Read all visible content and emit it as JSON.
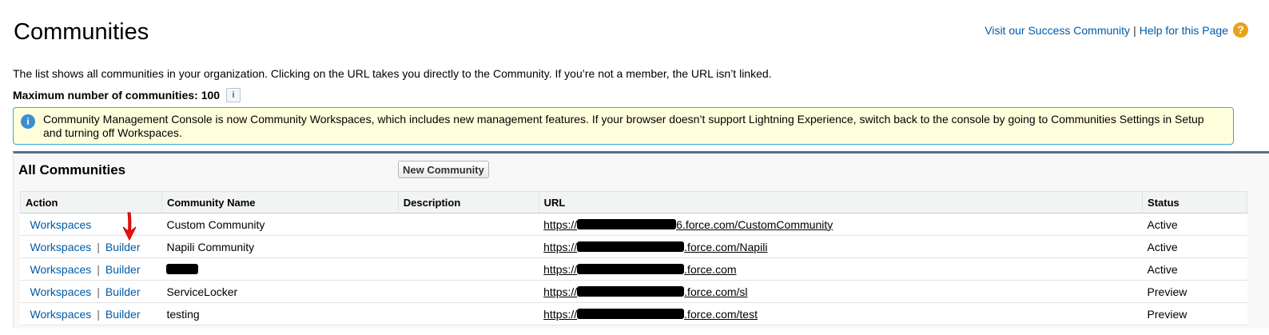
{
  "header": {
    "title": "Communities",
    "success_link": "Visit our Success Community",
    "separator": "|",
    "help_link": "Help for this Page",
    "help_icon": "help-icon"
  },
  "intro": {
    "description": "The list shows all communities in your organization. Clicking on the URL takes you directly to the Community. If you’re not a member, the URL isn’t linked.",
    "max_label": "Maximum number of communities: 100",
    "info_icon": "info-icon"
  },
  "banner": {
    "icon": "info-icon",
    "text": "Community Management Console is now Community Workspaces, which includes new management features. If your browser doesn’t support Lightning Experience, switch back to the console by going to Communities Settings in Setup and turning off Workspaces."
  },
  "panel": {
    "title": "All Communities",
    "new_button": "New Community"
  },
  "table": {
    "columns": [
      "Action",
      "Community Name",
      "Description",
      "URL",
      "Status"
    ],
    "rows": [
      {
        "workspaces": "Workspaces",
        "builder": "",
        "name": "Custom Community",
        "description": "",
        "url_prefix": "https://",
        "url_suffix": "6.force.com/CustomCommunity",
        "status": "Active"
      },
      {
        "workspaces": "Workspaces",
        "builder": "Builder",
        "name": "Napili Community",
        "description": "",
        "url_prefix": "https://",
        "url_suffix": ".force.com/Napili",
        "status": "Active"
      },
      {
        "workspaces": "Workspaces",
        "builder": "Builder",
        "name": "",
        "description": "",
        "url_prefix": "https://",
        "url_suffix": ".force.com",
        "status": "Active"
      },
      {
        "workspaces": "Workspaces",
        "builder": "Builder",
        "name": "ServiceLocker",
        "description": "",
        "url_prefix": "https://",
        "url_suffix": ".force.com/sl",
        "status": "Preview"
      },
      {
        "workspaces": "Workspaces",
        "builder": "Builder",
        "name": "testing",
        "description": "",
        "url_prefix": "https://",
        "url_suffix": ".force.com/test",
        "status": "Preview"
      }
    ]
  },
  "annotation": {
    "icon": "arrow-down-icon",
    "color": "#e8140f"
  },
  "colors": {
    "link": "#015ba7",
    "banner_bg": "#ffffdc",
    "banner_border": "#39a7dd",
    "panel_border": "#56708d"
  }
}
